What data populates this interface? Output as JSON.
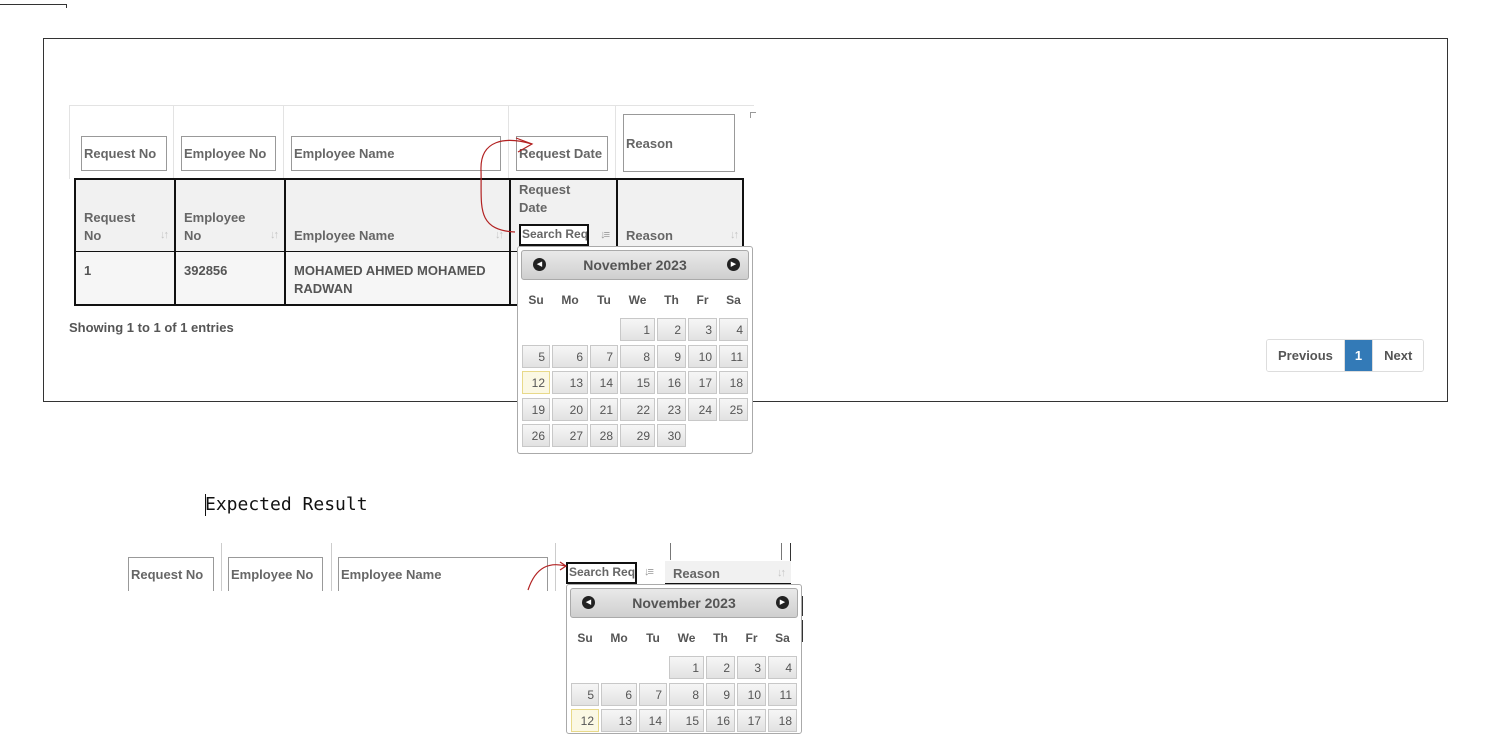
{
  "filters": {
    "request_no": "Request No",
    "employee_no": "Employee No",
    "employee_name": "Employee Name",
    "request_date": "Request Date",
    "reason": "Reason"
  },
  "columns": {
    "request_no_line1": "Request",
    "request_no_line2": "No",
    "employee_no_line1": "Employee",
    "employee_no_line2": "No",
    "employee_name": "Employee Name",
    "request_date_line1": "Request",
    "request_date_line2": "Date",
    "search_placeholder": "Search Req",
    "reason": "Reason"
  },
  "rows": [
    {
      "request_no": "1",
      "employee_no": "392856",
      "employee_name_line1": "MOHAMED AHMED MOHAMED",
      "employee_name_line2": "RADWAN"
    }
  ],
  "info": "Showing 1 to 1 of 1 entries",
  "pagination": {
    "previous": "Previous",
    "current": "1",
    "next": "Next"
  },
  "calendar": {
    "title": "November 2023",
    "weekdays": [
      "Su",
      "Mo",
      "Tu",
      "We",
      "Th",
      "Fr",
      "Sa"
    ],
    "first_weekday_index": 3,
    "days": [
      "1",
      "2",
      "3",
      "4",
      "5",
      "6",
      "7",
      "8",
      "9",
      "10",
      "11",
      "12",
      "13",
      "14",
      "15",
      "16",
      "17",
      "18",
      "19",
      "20",
      "21",
      "22",
      "23",
      "24",
      "25",
      "26",
      "27",
      "28",
      "29",
      "30"
    ],
    "today": "12"
  },
  "expected_title": "Expected Result",
  "expected": {
    "request_no": "Request No",
    "employee_no": "Employee No",
    "employee_name": "Employee Name",
    "search_placeholder": "Search Req",
    "reason": "Reason",
    "calendar_title": "November 2023",
    "visible_days": [
      "1",
      "2",
      "3",
      "4",
      "5",
      "6",
      "7",
      "8",
      "9",
      "10",
      "11",
      "12",
      "13",
      "14",
      "15",
      "16",
      "17",
      "18"
    ]
  },
  "colors": {
    "accent": "#337ab7",
    "today_bg": "#fbf8e4",
    "annotation": "#b22222"
  }
}
